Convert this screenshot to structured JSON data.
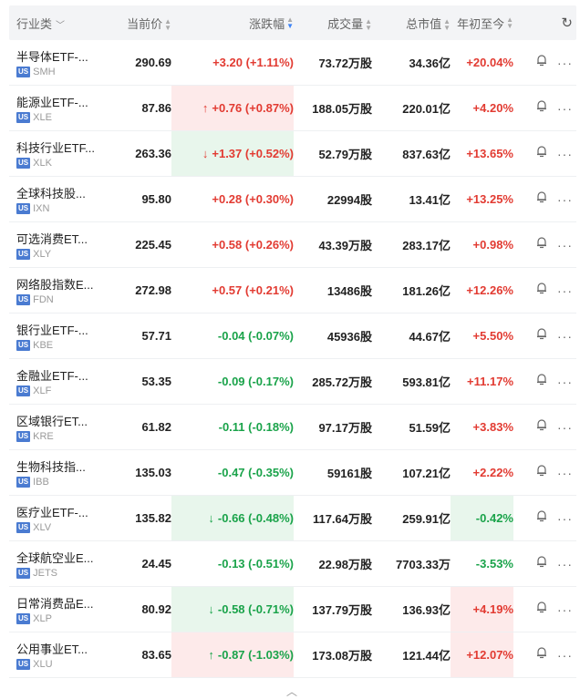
{
  "header": {
    "name": "行业类",
    "price": "当前价",
    "change": "涨跌幅",
    "volume": "成交量",
    "market_cap": "总市值",
    "ytd": "年初至今"
  },
  "market_badge": "US",
  "colors": {
    "up": "#e23b32",
    "down": "#1aa34a",
    "up_bg": "#fdeaea",
    "down_bg": "#e8f6ec",
    "badge": "#4a7bd1"
  },
  "rows": [
    {
      "name": "半导体ETF-...",
      "ticker": "SMH",
      "price": "290.69",
      "change": "+3.20 (+1.11%)",
      "dir": "up",
      "arrow": "",
      "chg_hl": "",
      "volume": "73.72万股",
      "cap": "34.36亿",
      "ytd": "+20.04%",
      "ytd_dir": "up",
      "ytd_hl": ""
    },
    {
      "name": "能源业ETF-...",
      "ticker": "XLE",
      "price": "87.86",
      "change": "+0.76 (+0.87%)",
      "dir": "up",
      "arrow": "↑",
      "chg_hl": "up",
      "volume": "188.05万股",
      "cap": "220.01亿",
      "ytd": "+4.20%",
      "ytd_dir": "up",
      "ytd_hl": ""
    },
    {
      "name": "科技行业ETF...",
      "ticker": "XLK",
      "price": "263.36",
      "change": "+1.37 (+0.52%)",
      "dir": "up",
      "arrow": "↓",
      "chg_hl": "down",
      "volume": "52.79万股",
      "cap": "837.63亿",
      "ytd": "+13.65%",
      "ytd_dir": "up",
      "ytd_hl": ""
    },
    {
      "name": "全球科技股...",
      "ticker": "IXN",
      "price": "95.80",
      "change": "+0.28 (+0.30%)",
      "dir": "up",
      "arrow": "",
      "chg_hl": "",
      "volume": "22994股",
      "cap": "13.41亿",
      "ytd": "+13.25%",
      "ytd_dir": "up",
      "ytd_hl": ""
    },
    {
      "name": "可选消费ET...",
      "ticker": "XLY",
      "price": "225.45",
      "change": "+0.58 (+0.26%)",
      "dir": "up",
      "arrow": "",
      "chg_hl": "",
      "volume": "43.39万股",
      "cap": "283.17亿",
      "ytd": "+0.98%",
      "ytd_dir": "up",
      "ytd_hl": ""
    },
    {
      "name": "网络股指数E...",
      "ticker": "FDN",
      "price": "272.98",
      "change": "+0.57 (+0.21%)",
      "dir": "up",
      "arrow": "",
      "chg_hl": "",
      "volume": "13486股",
      "cap": "181.26亿",
      "ytd": "+12.26%",
      "ytd_dir": "up",
      "ytd_hl": ""
    },
    {
      "name": "银行业ETF-...",
      "ticker": "KBE",
      "price": "57.71",
      "change": "-0.04 (-0.07%)",
      "dir": "down",
      "arrow": "",
      "chg_hl": "",
      "volume": "45936股",
      "cap": "44.67亿",
      "ytd": "+5.50%",
      "ytd_dir": "up",
      "ytd_hl": ""
    },
    {
      "name": "金融业ETF-...",
      "ticker": "XLF",
      "price": "53.35",
      "change": "-0.09 (-0.17%)",
      "dir": "down",
      "arrow": "",
      "chg_hl": "",
      "volume": "285.72万股",
      "cap": "593.81亿",
      "ytd": "+11.17%",
      "ytd_dir": "up",
      "ytd_hl": ""
    },
    {
      "name": "区域银行ET...",
      "ticker": "KRE",
      "price": "61.82",
      "change": "-0.11 (-0.18%)",
      "dir": "down",
      "arrow": "",
      "chg_hl": "",
      "volume": "97.17万股",
      "cap": "51.59亿",
      "ytd": "+3.83%",
      "ytd_dir": "up",
      "ytd_hl": ""
    },
    {
      "name": "生物科技指...",
      "ticker": "IBB",
      "price": "135.03",
      "change": "-0.47 (-0.35%)",
      "dir": "down",
      "arrow": "",
      "chg_hl": "",
      "volume": "59161股",
      "cap": "107.21亿",
      "ytd": "+2.22%",
      "ytd_dir": "up",
      "ytd_hl": ""
    },
    {
      "name": "医疗业ETF-...",
      "ticker": "XLV",
      "price": "135.82",
      "change": "-0.66 (-0.48%)",
      "dir": "down",
      "arrow": "↓",
      "chg_hl": "down",
      "volume": "117.64万股",
      "cap": "259.91亿",
      "ytd": "-0.42%",
      "ytd_dir": "down",
      "ytd_hl": "down"
    },
    {
      "name": "全球航空业E...",
      "ticker": "JETS",
      "price": "24.45",
      "change": "-0.13 (-0.51%)",
      "dir": "down",
      "arrow": "",
      "chg_hl": "",
      "volume": "22.98万股",
      "cap": "7703.33万",
      "ytd": "-3.53%",
      "ytd_dir": "down",
      "ytd_hl": ""
    },
    {
      "name": "日常消费品E...",
      "ticker": "XLP",
      "price": "80.92",
      "change": "-0.58 (-0.71%)",
      "dir": "down",
      "arrow": "↓",
      "chg_hl": "down",
      "volume": "137.79万股",
      "cap": "136.93亿",
      "ytd": "+4.19%",
      "ytd_dir": "up",
      "ytd_hl": "up"
    },
    {
      "name": "公用事业ET...",
      "ticker": "XLU",
      "price": "83.65",
      "change": "-0.87 (-1.03%)",
      "dir": "down",
      "arrow": "↑",
      "chg_hl": "up",
      "volume": "173.08万股",
      "cap": "121.44亿",
      "ytd": "+12.07%",
      "ytd_dir": "up",
      "ytd_hl": "up"
    }
  ]
}
